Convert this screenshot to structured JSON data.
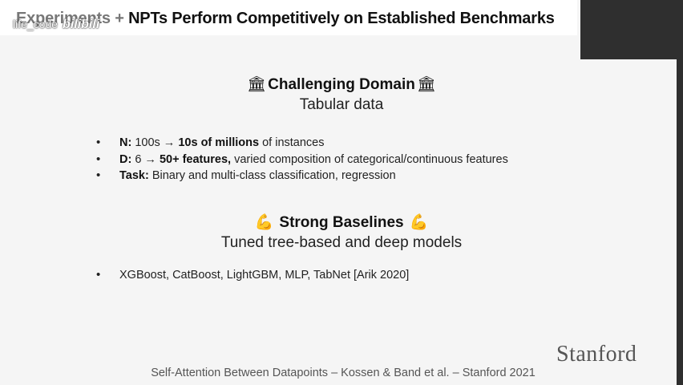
{
  "header": {
    "title_lead": "Experiments",
    "title_sep": " + ",
    "title_main": "NPTs Perform Competitively on Established Benchmarks"
  },
  "watermark": {
    "user": "life_code",
    "brand": "bilibili"
  },
  "section1": {
    "emoji": "🏛",
    "heading": "Challenging Domain",
    "subheading": "Tabular data",
    "bullets": [
      {
        "bold": "N:",
        "pre": " 100s → ",
        "bold2": "10s of millions",
        "post": " of instances"
      },
      {
        "bold": "D:",
        "pre": " 6 → ",
        "bold2": "50+ features,",
        "post": " varied composition of categorical/continuous features"
      },
      {
        "bold": "Task:",
        "pre": " Binary and multi-class classification, regression",
        "bold2": "",
        "post": ""
      }
    ]
  },
  "section2": {
    "emoji": "💪",
    "heading": "Strong Baselines",
    "subheading": "Tuned tree-based and deep models",
    "bullets": [
      {
        "text": "XGBoost, CatBoost, LightGBM, MLP, TabNet [Arik 2020]"
      }
    ]
  },
  "logo": "Stanford",
  "footer": "Self-Attention Between Datapoints – Kossen & Band et al. – Stanford 2021"
}
